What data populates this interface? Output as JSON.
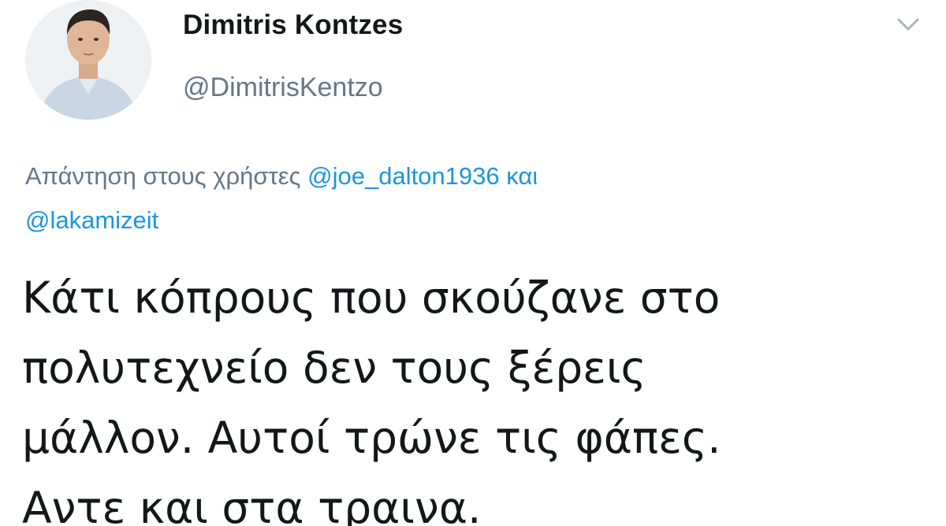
{
  "author": {
    "display_name": "Dimitris Kontzes",
    "handle": "@DimitrisKentzo",
    "avatar_icon": "profile-photo"
  },
  "menu": {
    "icon": "chevron-down-icon"
  },
  "reply_context": {
    "prefix": "Απάντηση στους χρήστες",
    "mention_1": "@joe_dalton1936",
    "conjunction": "και",
    "mention_2": "@lakamizeit"
  },
  "tweet": {
    "line_1": "Κάτι κόπρους που σκούζανε στο",
    "line_2": "πολυτεχνείο δεν τους ξέρεις",
    "line_3": "μάλλον. Αυτοί τρώνε τις φάπες.",
    "line_4": "Αντε και στα τραινα."
  },
  "colors": {
    "text_primary": "#14171a",
    "text_secondary": "#657786",
    "link": "#1b95e0"
  }
}
